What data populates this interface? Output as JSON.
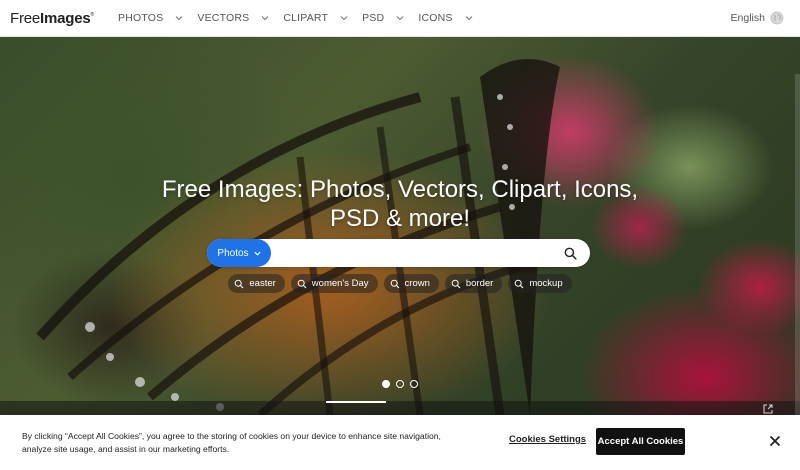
{
  "header": {
    "logo": {
      "free": "Free",
      "images": "Images",
      "mark": "®"
    },
    "nav": [
      {
        "label": "PHOTOS"
      },
      {
        "label": "VECTORS"
      },
      {
        "label": "CLIPART"
      },
      {
        "label": "PSD"
      },
      {
        "label": "ICONS"
      }
    ],
    "language": "English"
  },
  "hero": {
    "title_line1": "Free Images: Photos, Vectors, Clipart, Icons,",
    "title_line2": "PSD & more!",
    "search": {
      "type_label": "Photos",
      "placeholder": "",
      "value": ""
    },
    "tags": [
      {
        "label": "easter"
      },
      {
        "label": "women's Day"
      },
      {
        "label": "crown"
      },
      {
        "label": "border"
      },
      {
        "label": "mockup"
      }
    ],
    "carousel": {
      "slides": 3,
      "active": 0
    }
  },
  "cookie": {
    "text": "By clicking “Accept All Cookies”, you agree to the storing of cookies on your device to enhance site navigation, analyze site usage, and assist in our marketing efforts.",
    "settings_label": "Cookies Settings",
    "accept_label": "Accept All Cookies"
  },
  "colors": {
    "accent": "#1e73e8",
    "accept_button": "#111111"
  }
}
